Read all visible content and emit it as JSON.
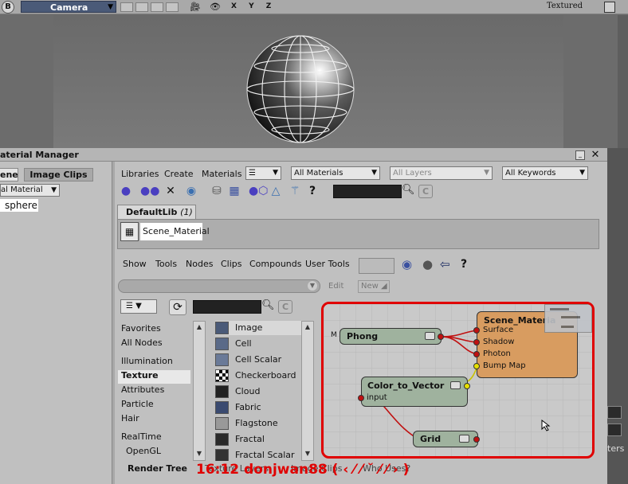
{
  "viewport": {
    "menu_letter": "B",
    "camera_label": "Camera",
    "axes_label": "X Y Z",
    "display_mode": "Textured"
  },
  "material_manager": {
    "title": "aterial Manager",
    "left_panel": {
      "tab_scene": "ene",
      "tab_image_clips": "Image Clips",
      "dropdown_value": "al Material",
      "selected_object": "sphere"
    },
    "menus": [
      "Libraries",
      "Create",
      "Materials"
    ],
    "filter_all_materials": "All Materials",
    "filter_all_layers": "All Layers",
    "filter_all_keywords": "All Keywords",
    "library_tab": {
      "name": "DefaultLib",
      "count": "(1)"
    },
    "material_item": "Scene_Material"
  },
  "render_tree": {
    "menus": [
      "Show",
      "Tools",
      "Nodes",
      "Clips",
      "Compounds",
      "User Tools"
    ],
    "edit_label": "Edit",
    "new_label": "New",
    "categories": [
      "Favorites",
      "All Nodes",
      "Illumination",
      "Texture",
      "Attributes",
      "Particle",
      "Hair",
      "RealTime",
      "OpenGL"
    ],
    "selected_category": "Texture",
    "node_types": [
      "Image",
      "Cell",
      "Cell Scalar",
      "Checkerboard",
      "Cloud",
      "Fabric",
      "Flagstone",
      "Fractal",
      "Fractal Scalar"
    ],
    "graph": {
      "phong": {
        "name": "Phong",
        "marker": "M"
      },
      "scene_material": {
        "name": "Scene_Materia",
        "ports": [
          "Surface",
          "Shadow",
          "Photon",
          "Bump Map"
        ]
      },
      "color_to_vector": {
        "name": "Color_to_Vector",
        "port": "input"
      },
      "grid": {
        "name": "Grid"
      }
    }
  },
  "bottom_tabs": {
    "render_tree": "Render Tree",
    "texture_layers": "Texture Layers",
    "image_clips": "Image Clips",
    "who_uses": "Who Uses?"
  },
  "overlay_text": "16:12  donjwan88 ( ‹ ⁄ ⁄ ˘ ⁄ ⁄ › )",
  "outer_right_text": "ters"
}
